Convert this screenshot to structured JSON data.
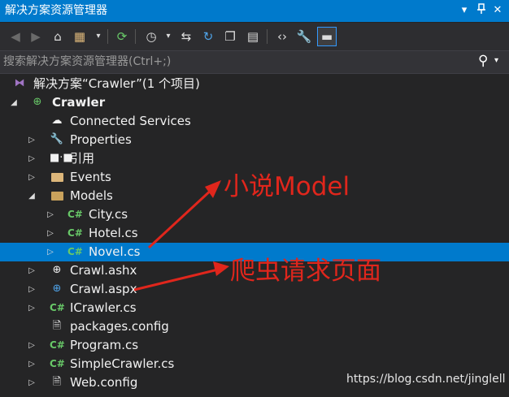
{
  "window": {
    "title": "解决方案资源管理器",
    "controls": {
      "dropdown_icon": "dropdown-icon",
      "pin_icon": "pin-icon",
      "close_icon": "close-icon"
    }
  },
  "toolbar": {
    "buttons": [
      "back-icon",
      "forward-icon",
      "home-icon",
      "switch-views-icon",
      "pending-changes-icon",
      "history-icon",
      "sync-icon",
      "refresh-icon",
      "collapse-all-icon",
      "show-all-files-icon",
      "code-view-icon",
      "properties-icon",
      "preview-icon"
    ]
  },
  "search": {
    "placeholder": "搜索解决方案资源管理器(Ctrl+;)"
  },
  "tree": {
    "solution": "解决方案“Crawler”(1 个项目)",
    "project": "Crawler",
    "items": [
      {
        "label": "Connected Services"
      },
      {
        "label": "Properties"
      },
      {
        "label": "引用"
      },
      {
        "label": "Events"
      },
      {
        "label": "Models"
      },
      {
        "label": "City.cs"
      },
      {
        "label": "Hotel.cs"
      },
      {
        "label": "Novel.cs"
      },
      {
        "label": "Crawl.ashx"
      },
      {
        "label": "Crawl.aspx"
      },
      {
        "label": "ICrawler.cs"
      },
      {
        "label": "packages.config"
      },
      {
        "label": "Program.cs"
      },
      {
        "label": "SimpleCrawler.cs"
      },
      {
        "label": "Web.config"
      }
    ],
    "csharp_badge": "C#"
  },
  "annotations": {
    "model_note": "小说Model",
    "crawler_note": "爬虫请求页面",
    "color": "#e0261c"
  },
  "watermark": "https://blog.csdn.net/jinglell",
  "colors": {
    "accent": "#007acc",
    "background": "#252526",
    "selection": "#007acc"
  }
}
